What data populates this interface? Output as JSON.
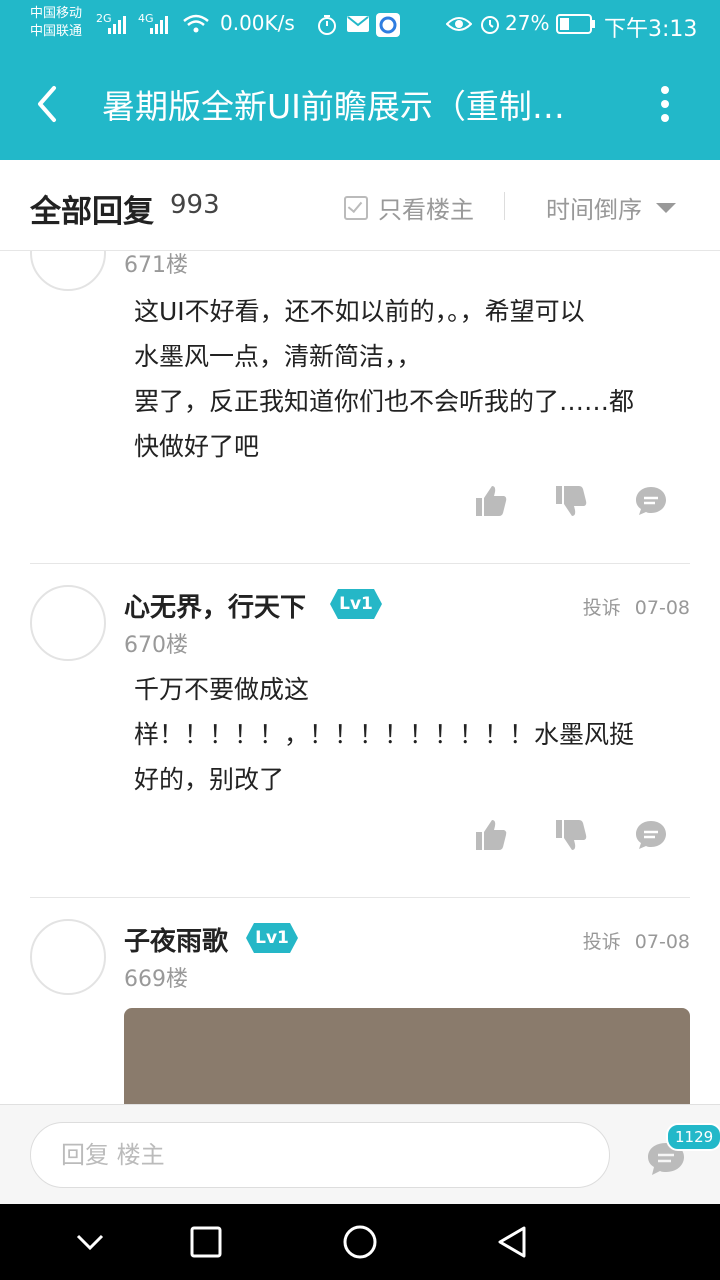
{
  "status_bar": {
    "carrier_1": "中国移动",
    "carrier_2": "中国联通",
    "net_1": "2G",
    "net_2": "4G",
    "speed": "0.00K/s",
    "battery": "27%",
    "time": "下午3:13"
  },
  "header": {
    "title": "暑期版全新UI前瞻展示（重制…"
  },
  "subheader": {
    "all_replies_label": "全部回复",
    "reply_count": "993",
    "only_op_label": "只看楼主",
    "sort_label": "时间倒序"
  },
  "posts": [
    {
      "floor": "671楼",
      "lines": [
        "这UI不好看，还不如以前的，。，希望可以",
        "水墨风一点，清新简洁，，",
        "罢了，反正我知道你们也不会听我的了……都",
        "快做好了吧"
      ]
    },
    {
      "username": "心无界，行天下",
      "level": "Lv1",
      "report": "投诉",
      "date": "07-08",
      "floor": "670楼",
      "lines": [
        "千万不要做成这",
        "样！！！！！，！！！！！！！！！水墨风挺",
        "好的，别改了"
      ]
    },
    {
      "username": "子夜雨歌",
      "level": "Lv1",
      "report": "投诉",
      "date": "07-08",
      "floor": "669楼"
    }
  ],
  "bottom_bar": {
    "reply_placeholder": "回复  楼主",
    "comment_count": "1129"
  },
  "icons": {
    "like": "thumbs-up-icon",
    "dislike": "thumbs-down-icon",
    "reply": "comment-bubble-icon"
  },
  "colors": {
    "accent": "#22b8c9",
    "level_badge": "#25b7c7"
  }
}
